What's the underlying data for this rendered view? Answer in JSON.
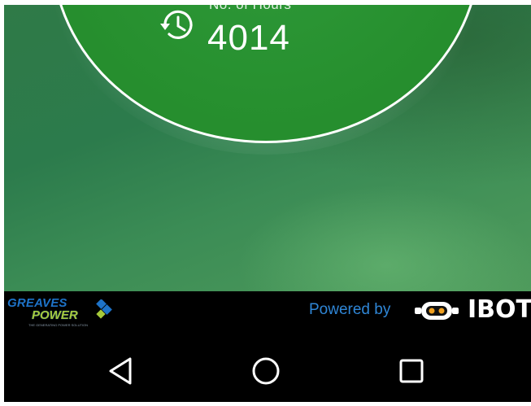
{
  "dial": {
    "hours_label": "No. of Hours",
    "hours_value": "4014",
    "icon": "history-clock-icon"
  },
  "brand_bar": {
    "greaves_top": "GREAVES",
    "greaves_bottom": "POWER",
    "greaves_tagline": "THE GENERATING POWER SOLUTION",
    "powered_by": "Powered by",
    "ibot_text": "IBOT",
    "colors": {
      "greaves_blue": "#1e73c8",
      "greaves_green": "#a6c93a",
      "powered_by_blue": "#2f86d6",
      "ibot_orange": "#f0a020"
    }
  },
  "navbar": {
    "back_icon": "back-triangle-icon",
    "home_icon": "home-circle-icon",
    "recents_icon": "recents-square-icon"
  },
  "colors": {
    "dial_green": "#27902f",
    "background_green": "#2f7a47",
    "ring": "#ffffff"
  }
}
